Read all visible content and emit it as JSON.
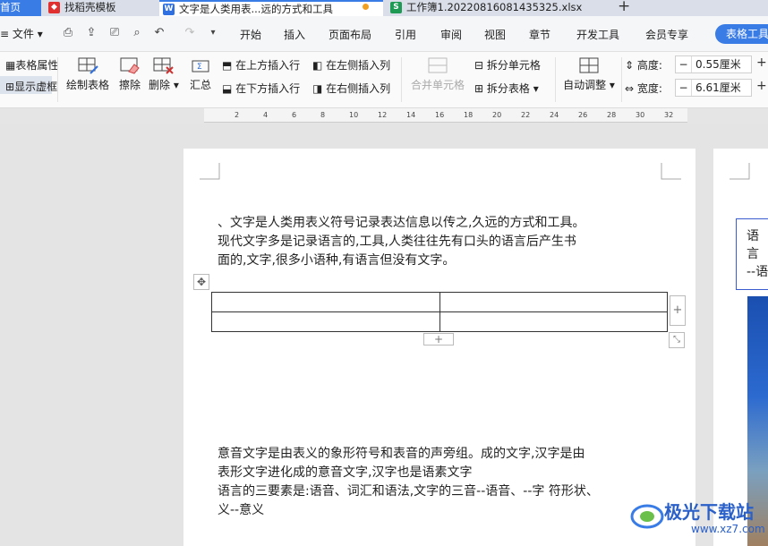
{
  "tabs": {
    "home": "首页",
    "template": "找稻壳模板",
    "doc": "文字是人类用表...远的方式和工具",
    "xls": "工作簿1.20220816081435325.xlsx",
    "add": "+"
  },
  "menu": {
    "file": "文件",
    "items": [
      "开始",
      "插入",
      "页面布局",
      "引用",
      "审阅",
      "视图",
      "章节",
      "开发工具",
      "会员专享"
    ],
    "active": "表格工具"
  },
  "ribbon": {
    "table_props": "表格属性",
    "show_borders": "显示虚框",
    "draw_table": "绘制表格",
    "erase": "擦除",
    "delete": "删除",
    "summary": "汇总",
    "insert_above": "在上方插入行",
    "insert_below": "在下方插入行",
    "insert_left": "在左侧插入列",
    "insert_right": "在右侧插入列",
    "merge_cells": "合并单元格",
    "split_cells": "拆分单元格",
    "split_table": "拆分表格",
    "auto_adjust": "自动调整",
    "height_label": "高度:",
    "height_value": "0.55厘米",
    "width_label": "宽度:",
    "width_value": "6.61厘米"
  },
  "ruler": [
    "2",
    "4",
    "6",
    "8",
    "10",
    "12",
    "14",
    "16",
    "18",
    "20",
    "22",
    "24",
    "26",
    "28",
    "30",
    "32"
  ],
  "page": {
    "line1": "、文字是人类用表义符号记录表达信息以传之,久远的方式和工具。",
    "line2": "现代文字多是记录语言的,工具,人类往往先有口头的语言后产生书",
    "line3": "面的,文字,很多小语种,有语言但没有文字。",
    "line4": "意音文字是由表义的象形符号和表音的声旁组。成的文字,汉字是由",
    "line5": "表形文字进化成的意音文字,汉字也是语素文字",
    "line6": "语言的三要素是:语音、词汇和语法,文字的三音--语音、--字 符形状、",
    "line7": "义--意义"
  },
  "page2": {
    "line1": "语言",
    "line2": "--语"
  },
  "watermark": {
    "name": "极光下载站",
    "url": "www.xz7.com"
  }
}
